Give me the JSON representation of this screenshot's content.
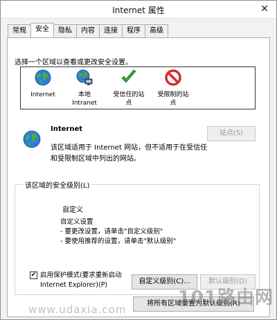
{
  "window": {
    "title": "Internet 属性",
    "close_glyph": "✕"
  },
  "tabs": [
    {
      "label": "常规"
    },
    {
      "label": "安全",
      "active": true
    },
    {
      "label": "隐私"
    },
    {
      "label": "内容"
    },
    {
      "label": "连接"
    },
    {
      "label": "程序"
    },
    {
      "label": "高级"
    }
  ],
  "security": {
    "instruction": "选择一个区域以查看或更改安全设置。",
    "zones": [
      {
        "line1": "Internet",
        "line2": "",
        "icon": "globe-icon"
      },
      {
        "line1": "本地",
        "line2": "Intranet",
        "icon": "local-intranet-icon"
      },
      {
        "line1": "受信任的站",
        "line2": "点",
        "icon": "checkmark-icon"
      },
      {
        "line1": "受限制的站",
        "line2": "点",
        "icon": "no-entry-icon"
      }
    ],
    "detail": {
      "title": "Internet",
      "desc_line1": "该区域适用于 Internet 网站，但不适用于在受信任",
      "desc_line2": "和受限制区域中列出的网站。",
      "sites_button": "站点(S)"
    },
    "level_group": {
      "label": "该区域的安全级别(L)",
      "level_title": "自定义",
      "desc_lines": [
        "自定义设置",
        "- 要更改设置，请单击\"自定义级别\"",
        "- 要使用推荐的设置，请单击\"默认级别\""
      ]
    },
    "protected_mode": {
      "checked": true,
      "check_glyph": "✔",
      "line1": "启用保护模式(要求重新启动",
      "line2": "Internet Explorer)(P)"
    },
    "buttons": {
      "custom_level": "自定义级别(C)...",
      "default_level": "默认级别(D)",
      "reset_all": "将所有区域重置为默认级别(R)"
    }
  },
  "watermarks": {
    "left": "www.udaxia.com",
    "right": "101路由网"
  },
  "colors": {
    "accent_blue": "#1e6fcf",
    "trusted_green": "#3aa23a",
    "restricted_red": "#d62b2b"
  }
}
